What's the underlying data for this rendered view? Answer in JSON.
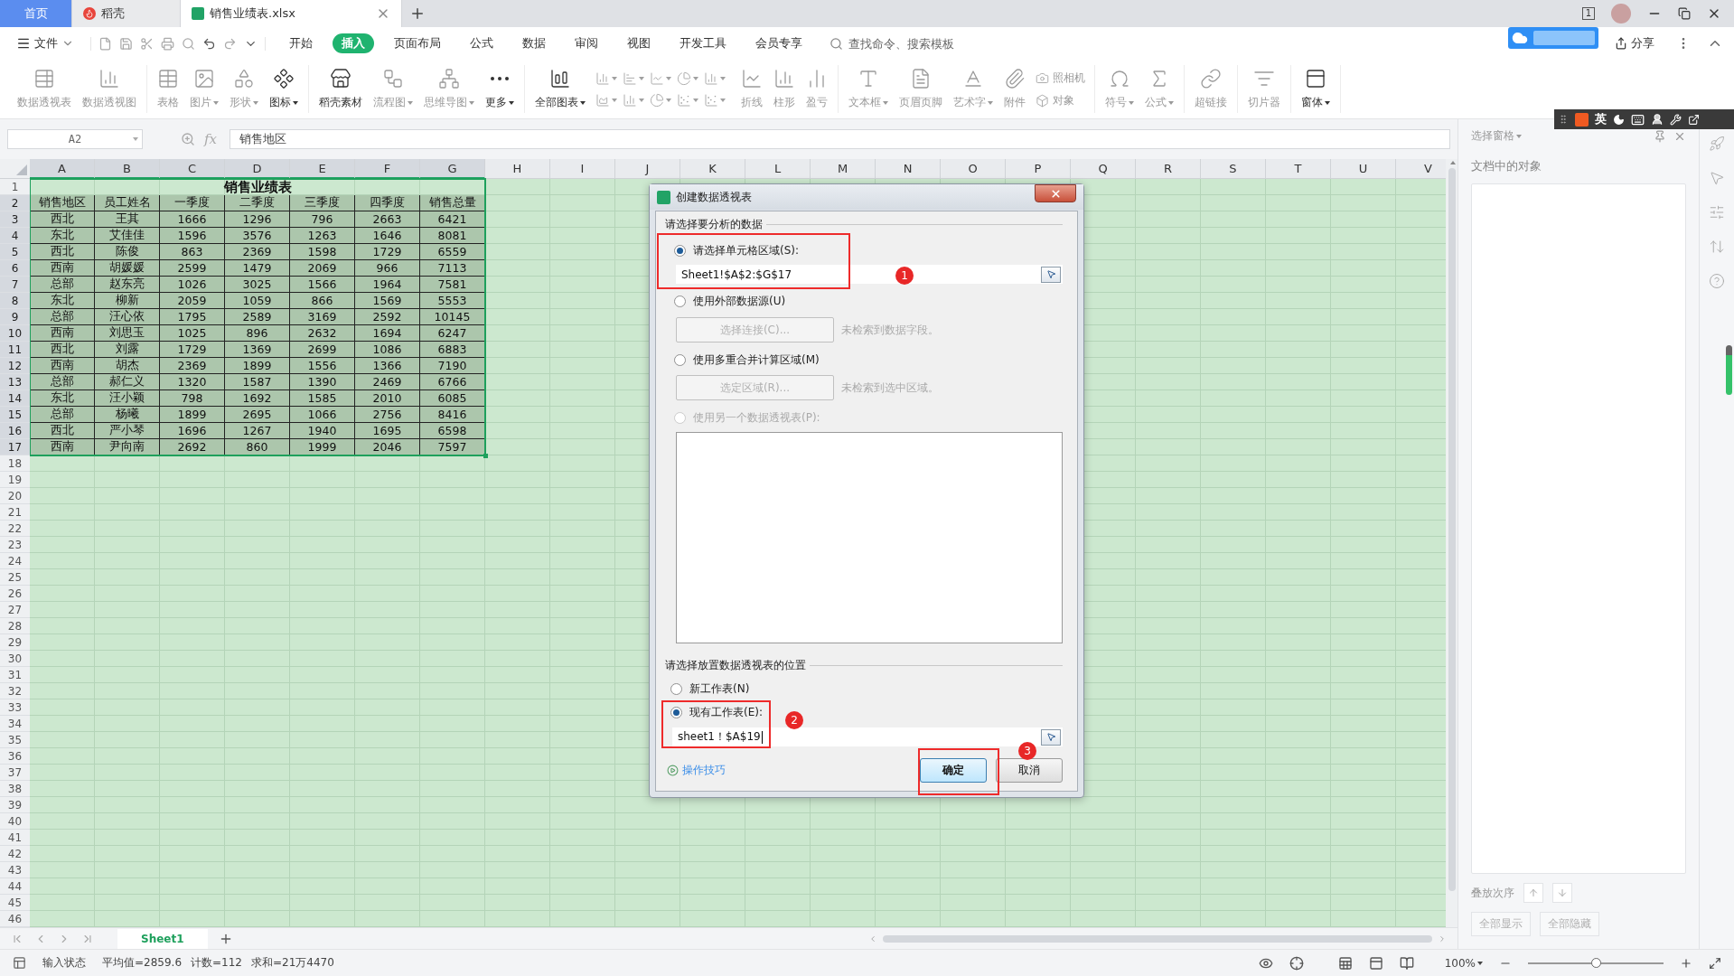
{
  "tabs": [
    {
      "label": "首页",
      "kind": "home",
      "selected": false
    },
    {
      "label": "稻壳",
      "kind": "docer",
      "selected": false
    },
    {
      "label": "销售业绩表.xlsx",
      "kind": "sheet",
      "selected": true
    }
  ],
  "window": {
    "tab_count": "1"
  },
  "menu": {
    "file": "文件",
    "items": [
      {
        "label": "开始",
        "selected": false
      },
      {
        "label": "插入",
        "selected": true
      },
      {
        "label": "页面布局",
        "selected": false
      },
      {
        "label": "公式",
        "selected": false
      },
      {
        "label": "数据",
        "selected": false
      },
      {
        "label": "审阅",
        "selected": false
      },
      {
        "label": "视图",
        "selected": false
      },
      {
        "label": "开发工具",
        "selected": false
      },
      {
        "label": "会员专享",
        "selected": false
      }
    ],
    "search": {
      "placeholder": "查找命令、搜索模板"
    },
    "share": "分享"
  },
  "ribbon": [
    {
      "items": [
        {
          "kind": "big",
          "label": "数据透视表",
          "disabled": true,
          "dropdown": false
        },
        {
          "kind": "big",
          "label": "数据透视图",
          "disabled": true,
          "dropdown": false
        }
      ]
    },
    {
      "items": [
        {
          "kind": "big",
          "label": "表格",
          "disabled": true,
          "dropdown": false
        },
        {
          "kind": "big",
          "label": "图片",
          "disabled": true,
          "dropdown": true
        },
        {
          "kind": "big",
          "label": "形状",
          "disabled": true,
          "dropdown": true
        },
        {
          "kind": "big",
          "label": "图标",
          "disabled": false,
          "dropdown": true
        }
      ]
    },
    {
      "items": [
        {
          "kind": "big",
          "label": "稻壳素材",
          "disabled": false,
          "dropdown": false
        },
        {
          "kind": "big",
          "label": "流程图",
          "disabled": true,
          "dropdown": true
        },
        {
          "kind": "big",
          "label": "思维导图",
          "disabled": true,
          "dropdown": true
        },
        {
          "kind": "big",
          "label": "更多",
          "disabled": false,
          "dropdown": true
        }
      ]
    },
    {
      "items": [
        {
          "kind": "big",
          "label": "全部图表",
          "disabled": false,
          "dropdown": true
        },
        {
          "kind": "chart-grid",
          "disabled": true
        },
        {
          "kind": "big",
          "label": "折线",
          "disabled": true,
          "dropdown": false
        },
        {
          "kind": "big",
          "label": "柱形",
          "disabled": true,
          "dropdown": false
        },
        {
          "kind": "big",
          "label": "盈亏",
          "disabled": true,
          "dropdown": false
        }
      ]
    },
    {
      "items": [
        {
          "kind": "big",
          "label": "文本框",
          "disabled": true,
          "dropdown": true
        },
        {
          "kind": "big",
          "label": "页眉页脚",
          "disabled": true,
          "dropdown": false
        },
        {
          "kind": "big",
          "label": "艺术字",
          "disabled": true,
          "dropdown": true
        },
        {
          "kind": "big",
          "label": "附件",
          "disabled": true,
          "dropdown": false
        },
        {
          "kind": "stack",
          "labels": [
            "照相机",
            "对象"
          ],
          "disabled": true
        }
      ]
    },
    {
      "items": [
        {
          "kind": "big",
          "label": "符号",
          "disabled": true,
          "dropdown": true
        },
        {
          "kind": "big",
          "label": "公式",
          "disabled": true,
          "dropdown": true
        }
      ]
    },
    {
      "items": [
        {
          "kind": "big",
          "label": "超链接",
          "disabled": true,
          "dropdown": false
        }
      ]
    },
    {
      "items": [
        {
          "kind": "big",
          "label": "切片器",
          "disabled": true,
          "dropdown": false
        }
      ]
    },
    {
      "items": [
        {
          "kind": "big",
          "label": "窗体",
          "disabled": false,
          "dropdown": true
        }
      ]
    }
  ],
  "ime": {
    "mode": "英"
  },
  "formula_bar": {
    "cell": "A2",
    "fx": "fx",
    "value": "销售地区"
  },
  "sheet": {
    "columns": [
      {
        "label": "A",
        "selected": true
      },
      {
        "label": "B",
        "selected": true
      },
      {
        "label": "C",
        "selected": true
      },
      {
        "label": "D",
        "selected": true
      },
      {
        "label": "E",
        "selected": true
      },
      {
        "label": "F",
        "selected": true
      },
      {
        "label": "G",
        "selected": true
      },
      {
        "label": "H",
        "selected": false
      },
      {
        "label": "I",
        "selected": false
      },
      {
        "label": "J",
        "selected": false
      },
      {
        "label": "K",
        "selected": false
      },
      {
        "label": "L",
        "selected": false
      },
      {
        "label": "M",
        "selected": false
      },
      {
        "label": "N",
        "selected": false
      },
      {
        "label": "O",
        "selected": false
      },
      {
        "label": "P",
        "selected": false
      },
      {
        "label": "Q",
        "selected": false
      },
      {
        "label": "R",
        "selected": false
      },
      {
        "label": "S",
        "selected": false
      },
      {
        "label": "T",
        "selected": false
      },
      {
        "label": "U",
        "selected": false
      },
      {
        "label": "V",
        "selected": false
      }
    ],
    "row_numbers": [
      {
        "label": "1",
        "selected": false
      },
      {
        "label": "2",
        "selected": true
      },
      {
        "label": "3",
        "selected": true
      },
      {
        "label": "4",
        "selected": true
      },
      {
        "label": "5",
        "selected": true
      },
      {
        "label": "6",
        "selected": true
      },
      {
        "label": "7",
        "selected": true
      },
      {
        "label": "8",
        "selected": true
      },
      {
        "label": "9",
        "selected": true
      },
      {
        "label": "10",
        "selected": true
      },
      {
        "label": "11",
        "selected": true
      },
      {
        "label": "12",
        "selected": true
      },
      {
        "label": "13",
        "selected": true
      },
      {
        "label": "14",
        "selected": true
      },
      {
        "label": "15",
        "selected": true
      },
      {
        "label": "16",
        "selected": true
      },
      {
        "label": "17",
        "selected": true
      },
      {
        "label": "18",
        "selected": false
      },
      {
        "label": "19",
        "selected": false
      },
      {
        "label": "20",
        "selected": false
      },
      {
        "label": "21",
        "selected": false
      },
      {
        "label": "22",
        "selected": false
      },
      {
        "label": "23",
        "selected": false
      },
      {
        "label": "24",
        "selected": false
      },
      {
        "label": "25",
        "selected": false
      },
      {
        "label": "26",
        "selected": false
      },
      {
        "label": "27",
        "selected": false
      },
      {
        "label": "28",
        "selected": false
      },
      {
        "label": "29",
        "selected": false
      },
      {
        "label": "30",
        "selected": false
      },
      {
        "label": "31",
        "selected": false
      },
      {
        "label": "32",
        "selected": false
      },
      {
        "label": "33",
        "selected": false
      },
      {
        "label": "34",
        "selected": false
      },
      {
        "label": "35",
        "selected": false
      },
      {
        "label": "36",
        "selected": false
      },
      {
        "label": "37",
        "selected": false
      },
      {
        "label": "38",
        "selected": false
      },
      {
        "label": "39",
        "selected": false
      },
      {
        "label": "40",
        "selected": false
      },
      {
        "label": "41",
        "selected": false
      },
      {
        "label": "42",
        "selected": false
      },
      {
        "label": "43",
        "selected": false
      },
      {
        "label": "44",
        "selected": false
      },
      {
        "label": "45",
        "selected": false
      },
      {
        "label": "46",
        "selected": false
      }
    ],
    "title": "销售业绩表",
    "rows": [
      {
        "selected": true,
        "cells": [
          "销售地区",
          "员工姓名",
          "一季度",
          "二季度",
          "三季度",
          "四季度",
          "销售总量"
        ]
      },
      {
        "selected": true,
        "cells": [
          "西北",
          "王其",
          "1666",
          "1296",
          "796",
          "2663",
          "6421"
        ]
      },
      {
        "selected": true,
        "cells": [
          "东北",
          "艾佳佳",
          "1596",
          "3576",
          "1263",
          "1646",
          "8081"
        ]
      },
      {
        "selected": true,
        "cells": [
          "西北",
          "陈俊",
          "863",
          "2369",
          "1598",
          "1729",
          "6559"
        ]
      },
      {
        "selected": true,
        "cells": [
          "西南",
          "胡媛媛",
          "2599",
          "1479",
          "2069",
          "966",
          "7113"
        ]
      },
      {
        "selected": true,
        "cells": [
          "总部",
          "赵东亮",
          "1026",
          "3025",
          "1566",
          "1964",
          "7581"
        ]
      },
      {
        "selected": true,
        "cells": [
          "东北",
          "柳新",
          "2059",
          "1059",
          "866",
          "1569",
          "5553"
        ]
      },
      {
        "selected": true,
        "cells": [
          "总部",
          "汪心依",
          "1795",
          "2589",
          "3169",
          "2592",
          "10145"
        ]
      },
      {
        "selected": true,
        "cells": [
          "西南",
          "刘思玉",
          "1025",
          "896",
          "2632",
          "1694",
          "6247"
        ]
      },
      {
        "selected": true,
        "cells": [
          "西北",
          "刘露",
          "1729",
          "1369",
          "2699",
          "1086",
          "6883"
        ]
      },
      {
        "selected": true,
        "cells": [
          "西南",
          "胡杰",
          "2369",
          "1899",
          "1556",
          "1366",
          "7190"
        ]
      },
      {
        "selected": true,
        "cells": [
          "总部",
          "郝仁义",
          "1320",
          "1587",
          "1390",
          "2469",
          "6766"
        ]
      },
      {
        "selected": true,
        "cells": [
          "东北",
          "汪小颖",
          "798",
          "1692",
          "1585",
          "2010",
          "6085"
        ]
      },
      {
        "selected": true,
        "cells": [
          "总部",
          "杨曦",
          "1899",
          "2695",
          "1066",
          "2756",
          "8416"
        ]
      },
      {
        "selected": true,
        "cells": [
          "西北",
          "严小琴",
          "1696",
          "1267",
          "1940",
          "1695",
          "6598"
        ]
      },
      {
        "selected": true,
        "cells": [
          "西南",
          "尹向南",
          "2692",
          "860",
          "1999",
          "2046",
          "7597"
        ]
      }
    ]
  },
  "dialog": {
    "title": "创建数据透视表",
    "source_heading": "请选择要分析的数据",
    "range_option": {
      "label": "请选择单元格区域(S):",
      "selected": true
    },
    "range_value": "Sheet1!$A$2:$G$17",
    "external_option": {
      "label": "使用外部数据源(U)",
      "selected": false
    },
    "connect_button": {
      "label": "选择连接(C)...",
      "disabled": true
    },
    "connect_note": "未检索到数据字段。",
    "consolidate_option": {
      "label": "使用多重合并计算区域(M)",
      "selected": false
    },
    "area_button": {
      "label": "选定区域(R)...",
      "disabled": true
    },
    "area_note": "未检索到选中区域。",
    "pivot_option": {
      "label": "使用另一个数据透视表(P):",
      "selected": false,
      "disabled": true
    },
    "destination_heading": "请选择放置数据透视表的位置",
    "destination_options": [
      {
        "label": "新工作表(N)",
        "selected": false
      },
      {
        "label": "现有工作表(E):",
        "selected": true
      }
    ],
    "location_value": "sheet1！$A$19",
    "location_focused": true,
    "tips_link": "操作技巧",
    "ok_button": "确定",
    "cancel_button": "取消",
    "annotations": [
      {
        "label": "1"
      },
      {
        "label": "2"
      },
      {
        "label": "3"
      }
    ]
  },
  "selection_pane": {
    "title": "选择窗格",
    "objects_label": "文档中的对象",
    "order_label": "叠放次序",
    "show_all": "全部显示",
    "hide_all": "全部隐藏"
  },
  "sheet_tabs": [
    {
      "label": "Sheet1",
      "selected": true
    }
  ],
  "status_bar": {
    "mode": "输入状态",
    "average": "平均值=2859.6",
    "count": "计数=112",
    "sum": "求和=21万4470",
    "zoom": "100%",
    "zoom_slider": {
      "level": 0.5
    }
  }
}
